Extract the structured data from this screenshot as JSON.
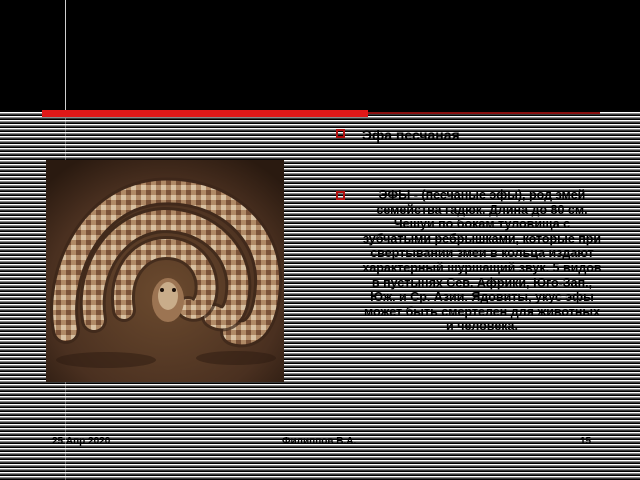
{
  "slide": {
    "bullets": [
      {
        "text": "Эфа песчаная"
      },
      {
        "text": "ЭФЫ - (песчаные эфы), род змей семейства гадюк. Длина до 80 см. Чешуи по бокам туловища с зубчатыми ребрышками, которые при свертывании змеи в кольца издают характерный шуршащий звук. 5 видов в пустынях Сев. Африки, Юго-Зап., Юж. и Ср. Азии. Ядовиты, укус эфы может быть смертелен для животных и человека."
      }
    ],
    "footer": {
      "date": "25 Апр 2020",
      "author": "Филиппов В.А.",
      "page": "15"
    }
  },
  "colors": {
    "accent_red": "#e01818",
    "background": "#000000"
  },
  "image": {
    "subject": "sand viper (saw-scaled viper) coiled on ground"
  }
}
